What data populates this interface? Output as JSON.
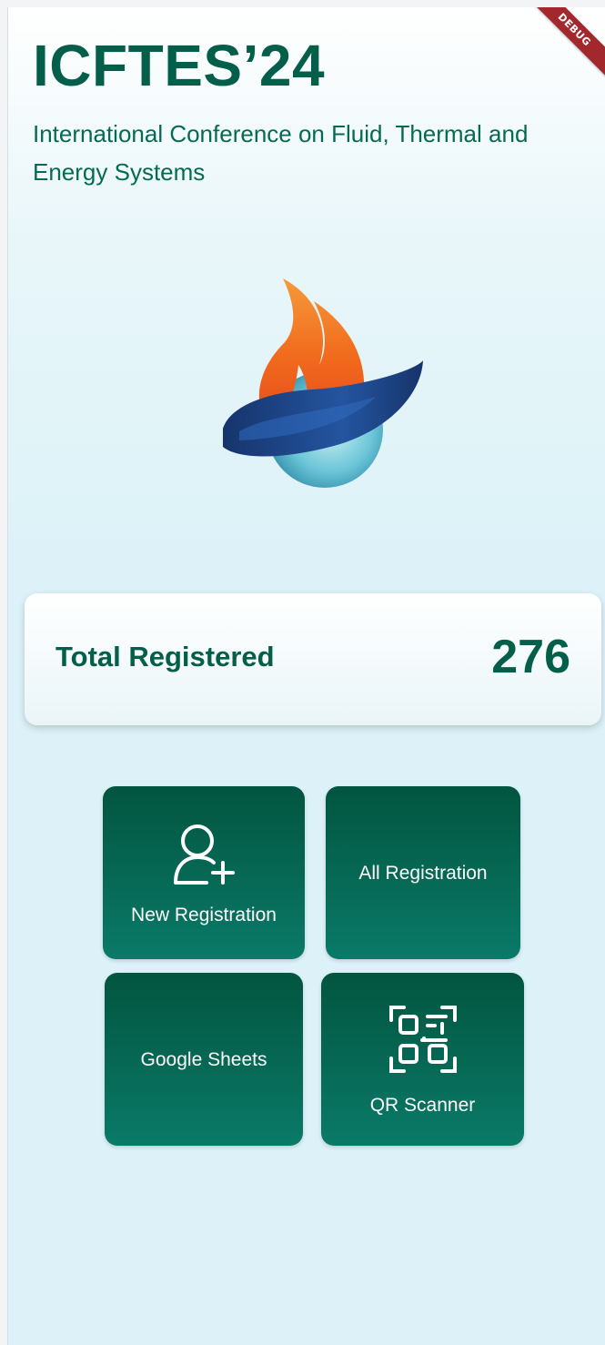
{
  "app": {
    "title": "ICFTES’24",
    "subtitle": "International Conference on Fluid, Thermal and Energy Systems",
    "debug_banner": "DEBUG"
  },
  "stats": {
    "label": "Total Registered",
    "value": "276"
  },
  "tiles": {
    "new_registration": {
      "label": "New Registration",
      "icon": "add-user-icon"
    },
    "all_registration": {
      "label": "All Registration"
    },
    "google_sheets": {
      "label": "Google Sheets"
    },
    "qr_scanner": {
      "label": "QR Scanner",
      "icon": "qr-code-icon"
    }
  },
  "colors": {
    "primary": "#045f4a",
    "tile_top": "#02553f",
    "tile_bottom": "#0a7a68",
    "background": "#dcf2f8",
    "debug_ribbon": "#a3282e",
    "logo_flame": "#f26b1d",
    "logo_ring": "#1d3f7a",
    "logo_globe": "#5fc3d6"
  }
}
